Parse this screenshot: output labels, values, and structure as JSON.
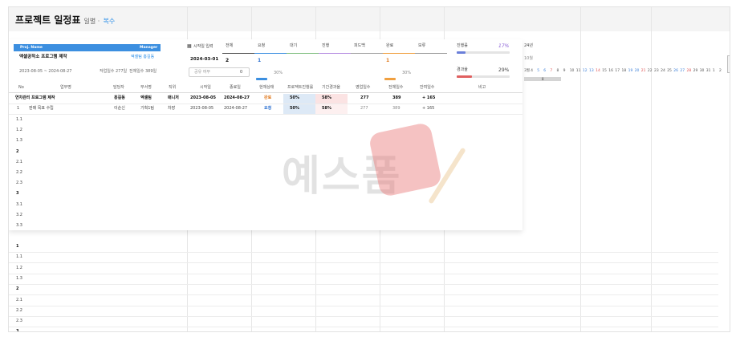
{
  "header": {
    "title": "프로젝트 일정표",
    "subtitle": "일별 ·",
    "mode": "복수"
  },
  "project": {
    "name_header": "Proj. Name",
    "manager_header": "Manager",
    "name": "엑셀공작소 프로그램 제작",
    "manager": "엑셀팀 홍길동",
    "period": "2023-08-05 ~ 2024-08-27",
    "work_days": "작업일수 277일",
    "total_days": "전체일수 389일"
  },
  "start_input": {
    "label": "시작일 입력",
    "value": "2024-03-01",
    "holiday_label": "공유 여부",
    "holiday_value": "0"
  },
  "status": {
    "headers": [
      "전체",
      "요청",
      "대기",
      "진행",
      "피드백",
      "완료",
      "보류"
    ],
    "counts": [
      "2",
      "1",
      "",
      "",
      "",
      "1",
      ""
    ],
    "percents": [
      "",
      "30%",
      "",
      "",
      "",
      "30%",
      ""
    ],
    "colors": [
      "#4d4d4d",
      "#3c8fe0",
      "#7fbf7f",
      "#b58be0",
      "#a0a0a0",
      "#f0a040",
      "#999999"
    ]
  },
  "progress": {
    "label": "진행률",
    "value": "17%",
    "value_fraction": 0.17,
    "elapsed_label": "경과율",
    "elapsed_value": "29%",
    "elapsed_fraction": 0.29
  },
  "calendar": {
    "year": "24년",
    "month": "10월",
    "days": [
      "3월",
      "4",
      "5",
      "6",
      "7",
      "8",
      "9",
      "10",
      "11",
      "12",
      "13",
      "14",
      "15",
      "16",
      "17",
      "18",
      "19",
      "20",
      "21",
      "22",
      "23",
      "24",
      "25",
      "26",
      "27",
      "28",
      "29",
      "30",
      "31",
      "1",
      "2"
    ],
    "weekend_colors": {
      "sat": "#3c7fd9",
      "sun": "#e05555"
    },
    "bar_label": "8"
  },
  "table": {
    "headers": [
      "No",
      "업무명",
      "담당자",
      "부서명",
      "직위",
      "시작일",
      "종료일",
      "현재상태",
      "프로젝트진행률",
      "기간경과율",
      "영업일수",
      "전체일수",
      "잔여일수",
      "비고"
    ],
    "rows": [
      {
        "no": "",
        "name": "연차관리 프로그램 제작",
        "owner": "홍길동",
        "dept": "엑셀팀",
        "pos": "매니저",
        "start": "2023-08-05",
        "end": "2024-08-27",
        "status": "완료",
        "progress": "50%",
        "elapsed": "58%",
        "workdays": "277",
        "total": "389",
        "remain": "+ 165"
      },
      {
        "no": "1",
        "name": "판매 목표 수립",
        "owner": "이순신",
        "dept": "기획1팀",
        "pos": "차장",
        "start": "2023-08-05",
        "end": "2024-08-27",
        "status": "요청",
        "progress": "50%",
        "elapsed": "58%",
        "workdays": "277",
        "total": "389",
        "remain": "+ 165"
      }
    ],
    "outline": [
      "1.1",
      "1.2",
      "1.3",
      "2",
      "2.1",
      "2.2",
      "2.3",
      "3",
      "3.1",
      "3.2",
      "3.3"
    ],
    "outline_lower": [
      "1",
      "1.1",
      "1.2",
      "1.3",
      "2",
      "2.1",
      "2.2",
      "2.3",
      "3"
    ]
  },
  "watermark": "예스폼"
}
